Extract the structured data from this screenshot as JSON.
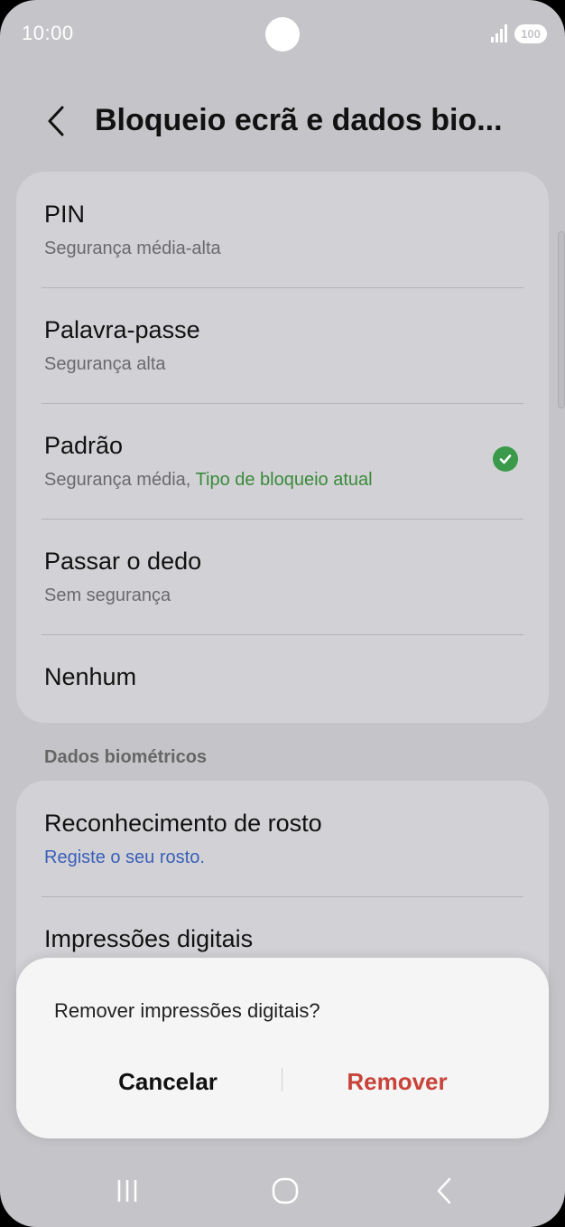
{
  "status": {
    "time": "10:00",
    "battery": "100"
  },
  "header": {
    "title": "Bloqueio ecrã e dados bio..."
  },
  "lock_options": [
    {
      "title": "PIN",
      "subtitle": "Segurança média-alta"
    },
    {
      "title": "Palavra-passe",
      "subtitle": "Segurança alta"
    },
    {
      "title": "Padrão",
      "subtitle": "Segurança média,",
      "current_label": "Tipo de bloqueio atual"
    },
    {
      "title": "Passar o dedo",
      "subtitle": "Sem segurança"
    },
    {
      "title": "Nenhum"
    }
  ],
  "biometrics": {
    "section_title": "Dados biométricos",
    "items": [
      {
        "title": "Reconhecimento de rosto",
        "subtitle": "Registe o seu rosto."
      },
      {
        "title": "Impressões digitais"
      }
    ]
  },
  "dialog": {
    "message": "Remover impressões digitais?",
    "cancel_label": "Cancelar",
    "remove_label": "Remover"
  },
  "colors": {
    "current_lock_green": "#3a8a3a",
    "link_blue": "#3a5fb8",
    "remove_red": "#c8433a"
  },
  "icons": [
    "signal-icon",
    "battery-icon",
    "back-arrow-icon",
    "check-circle-icon",
    "recent-apps-icon",
    "home-icon",
    "back-icon"
  ]
}
